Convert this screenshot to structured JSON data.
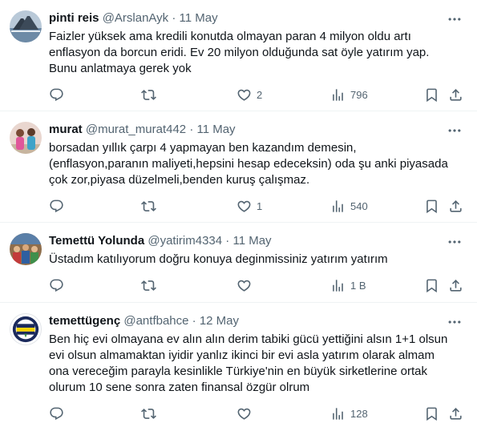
{
  "tweets": [
    {
      "name": "pinti reis",
      "handle": "@ArslanAyk",
      "separator": "·",
      "date": "11 May",
      "lines": [
        "Faizler yüksek ama kredili konutda olmayan paran 4 milyon oldu artı",
        "enflasyon da borcun eridi. Ev 20 milyon olduğunda sat öyle yatırım yap.",
        "Bunu anlatmaya gerek yok"
      ],
      "reply_count": "",
      "retweet_count": "",
      "like_count": "2",
      "view_count": "796"
    },
    {
      "name": "murat",
      "handle": "@murat_murat442",
      "separator": "·",
      "date": "11 May",
      "lines": [
        "borsadan yıllık çarpı 4 yapmayan ben kazandım demesin,",
        "(enflasyon,paranın maliyeti,hepsini hesap edeceksin) oda şu anki piyasada",
        "çok zor,piyasa düzelmeli,benden kuruş çalışmaz."
      ],
      "reply_count": "",
      "retweet_count": "",
      "like_count": "1",
      "view_count": "540"
    },
    {
      "name": "Temettü Yolunda",
      "handle": "@yatirim4334",
      "separator": "·",
      "date": "11 May",
      "lines": [
        "Üstadım katılıyorum doğru konuya deginmissiniz yatırım yatırım"
      ],
      "reply_count": "",
      "retweet_count": "",
      "like_count": "",
      "view_count": "1 B"
    },
    {
      "name": "temettügenç",
      "handle": "@antfbahce",
      "separator": "·",
      "date": "12 May",
      "lines": [
        "Ben hiç evi olmayana ev alın alın derim tabiki gücü yettiğini alsın 1+1  olsun",
        "evi olsun almamaktan iyidir yanlız ikinci bir evi asla yatırım olarak almam",
        "ona vereceğim parayla kesinlikle Türkiye'nin en büyük sirketlerine ortak",
        "olurum 10 sene sonra zaten finansal özgür olrum"
      ],
      "reply_count": "",
      "retweet_count": "",
      "like_count": "",
      "view_count": "128"
    }
  ],
  "icons": {
    "more": "more-icon",
    "reply": "reply-icon",
    "retweet": "retweet-icon",
    "like": "like-icon",
    "views": "views-icon",
    "bookmark": "bookmark-icon",
    "share": "share-icon"
  },
  "colors": {
    "text_primary": "#0f1419",
    "text_secondary": "#536471",
    "divider": "#eff3f4",
    "fenerbahce_yellow": "#f5d200",
    "fenerbahce_navy": "#1b2a5c"
  }
}
